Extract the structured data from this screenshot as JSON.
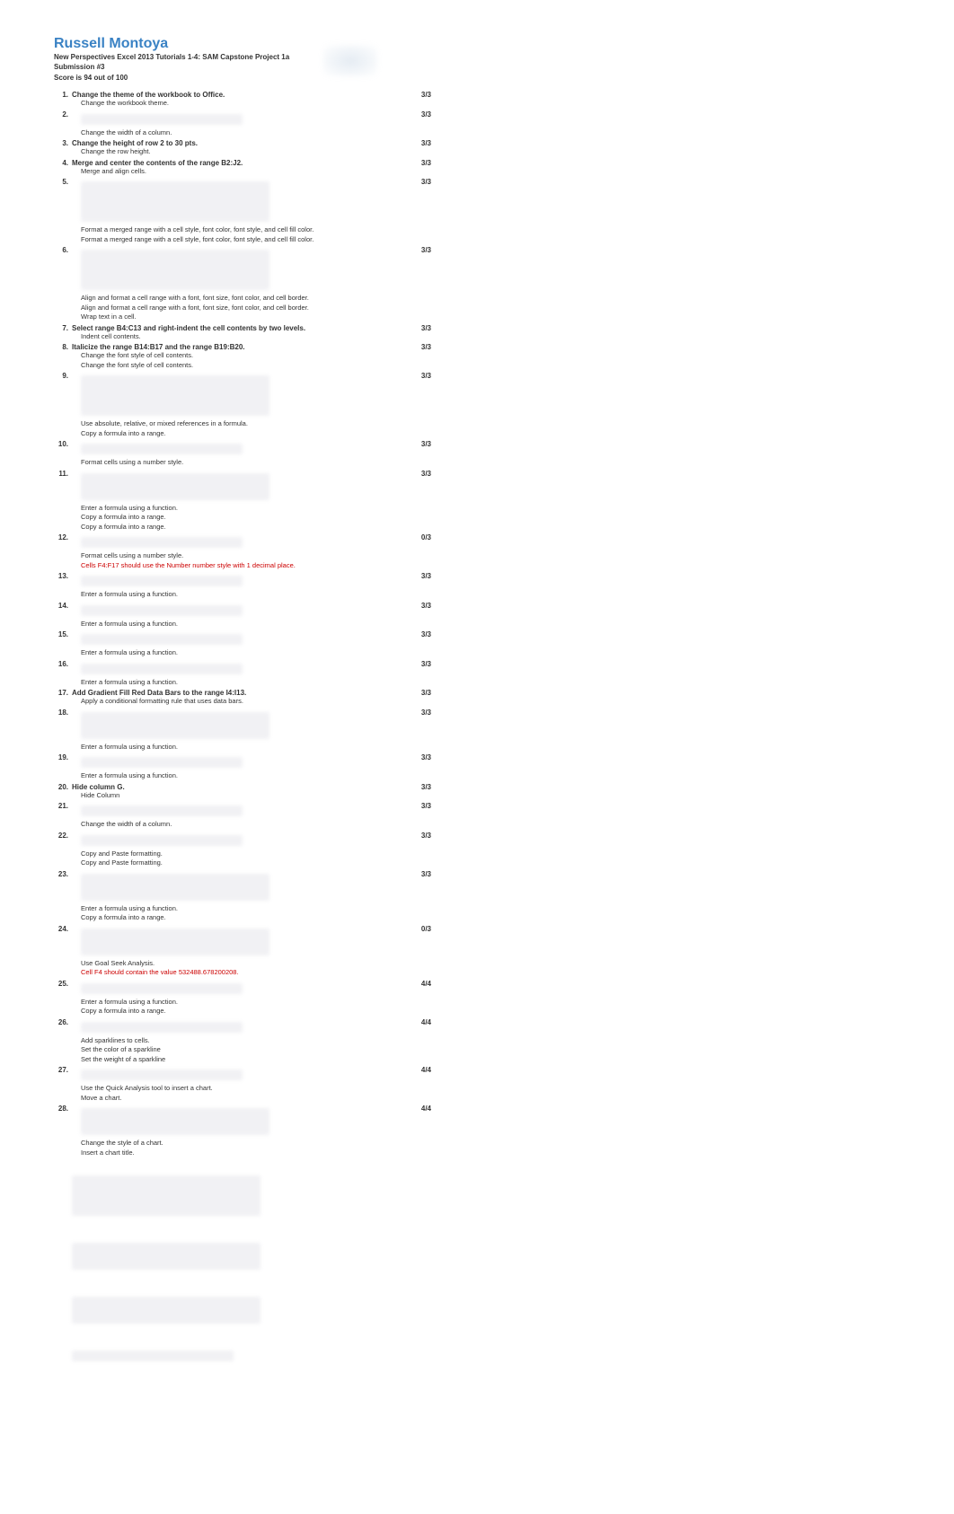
{
  "header": {
    "name": "Russell Montoya",
    "project": "New Perspectives Excel 2013 Tutorials 1-4: SAM Capstone Project 1a",
    "submission": "Submission #3",
    "score": "Score is 94 out of 100"
  },
  "items": [
    {
      "num": "1.",
      "title": "Change the theme of the workbook to Office.",
      "score": "3/3",
      "details": [
        {
          "t": "Change the workbook theme."
        }
      ]
    },
    {
      "num": "2.",
      "title": "",
      "score": "3/3",
      "blur": "sm",
      "details": [
        {
          "t": "Change the width of a column."
        }
      ]
    },
    {
      "num": "3.",
      "title": "Change the height of row 2 to 30 pts.",
      "score": "3/3",
      "details": [
        {
          "t": "Change the row height."
        }
      ]
    },
    {
      "num": "4.",
      "title": "Merge and center the contents of the range B2:J2.",
      "score": "3/3",
      "details": [
        {
          "t": "Merge and align cells."
        }
      ]
    },
    {
      "num": "5.",
      "title": "",
      "score": "3/3",
      "blur": "lg",
      "details": [
        {
          "t": "Format a merged range with a cell style, font color, font style, and cell fill color."
        },
        {
          "t": "Format a merged range with a cell style, font color, font style, and cell fill color."
        }
      ]
    },
    {
      "num": "6.",
      "title": "",
      "score": "3/3",
      "blur": "lg",
      "details": [
        {
          "t": "Align and format a cell range with a font, font size, font color, and cell border."
        },
        {
          "t": "Align and format a cell range with a font, font size, font color, and cell border."
        },
        {
          "t": "Wrap text in a cell."
        }
      ]
    },
    {
      "num": "7.",
      "title": "Select range B4:C13 and right-indent the cell contents by two levels.",
      "score": "3/3",
      "details": [
        {
          "t": "Indent cell contents."
        }
      ]
    },
    {
      "num": "8.",
      "title": "Italicize the range B14:B17 and the range B19:B20.",
      "score": "3/3",
      "details": [
        {
          "t": "Change the font style of cell contents."
        },
        {
          "t": "Change the font style of cell contents."
        }
      ]
    },
    {
      "num": "9.",
      "title": "",
      "score": "3/3",
      "blur": "lg",
      "details": [
        {
          "t": "Use absolute, relative, or mixed references in a formula."
        },
        {
          "t": "Copy a formula into a range."
        }
      ]
    },
    {
      "num": "10.",
      "title": "",
      "score": "3/3",
      "blur": "sm",
      "details": [
        {
          "t": "Format cells using a number style."
        }
      ]
    },
    {
      "num": "11.",
      "title": "",
      "score": "3/3",
      "blur": "md",
      "details": [
        {
          "t": "Enter a formula using a function."
        },
        {
          "t": "Copy a formula into a range."
        },
        {
          "t": "Copy a formula into a range."
        }
      ]
    },
    {
      "num": "12.",
      "title": "",
      "score": "0/3",
      "blur": "sm",
      "details": [
        {
          "t": "Format cells using a number style."
        },
        {
          "t": "Cells F4:F17 should use the Number number style with 1 decimal place.",
          "red": true
        }
      ]
    },
    {
      "num": "13.",
      "title": "",
      "score": "3/3",
      "blur": "sm",
      "details": [
        {
          "t": "Enter a formula using a function."
        }
      ]
    },
    {
      "num": "14.",
      "title": "",
      "score": "3/3",
      "blur": "sm",
      "details": [
        {
          "t": "Enter a formula using a function."
        }
      ]
    },
    {
      "num": "15.",
      "title": "",
      "score": "3/3",
      "blur": "sm",
      "details": [
        {
          "t": "Enter a formula using a function."
        }
      ]
    },
    {
      "num": "16.",
      "title": "",
      "score": "3/3",
      "blur": "sm",
      "details": [
        {
          "t": "Enter a formula using a function."
        }
      ]
    },
    {
      "num": "17.",
      "title": "Add Gradient Fill Red Data Bars to the range I4:I13.",
      "score": "3/3",
      "details": [
        {
          "t": "Apply a conditional formatting rule that uses data bars."
        }
      ]
    },
    {
      "num": "18.",
      "title": "",
      "score": "3/3",
      "blur": "md",
      "details": [
        {
          "t": "Enter a formula using a function."
        }
      ]
    },
    {
      "num": "19.",
      "title": "",
      "score": "3/3",
      "blur": "sm",
      "details": [
        {
          "t": "Enter a formula using a function."
        }
      ]
    },
    {
      "num": "20.",
      "title": "Hide column G.",
      "score": "3/3",
      "details": [
        {
          "t": "Hide Column"
        }
      ]
    },
    {
      "num": "21.",
      "title": "",
      "score": "3/3",
      "blur": "sm",
      "details": [
        {
          "t": "Change the width of a column."
        }
      ]
    },
    {
      "num": "22.",
      "title": "",
      "score": "3/3",
      "blur": "sm",
      "details": [
        {
          "t": "Copy and Paste formatting."
        },
        {
          "t": "Copy and Paste formatting."
        }
      ]
    },
    {
      "num": "23.",
      "title": "",
      "score": "3/3",
      "blur": "md",
      "details": [
        {
          "t": "Enter a formula using a function."
        },
        {
          "t": "Copy a formula into a range."
        }
      ]
    },
    {
      "num": "24.",
      "title": "",
      "score": "0/3",
      "blur": "md",
      "details": [
        {
          "t": "Use Goal Seek Analysis."
        },
        {
          "t": "Cell F4 should contain the value 532488.678200208.",
          "red": true
        }
      ]
    },
    {
      "num": "25.",
      "title": "",
      "score": "4/4",
      "blur": "sm",
      "details": [
        {
          "t": "Enter a formula using a function."
        },
        {
          "t": "Copy a formula into a range."
        }
      ]
    },
    {
      "num": "26.",
      "title": "",
      "score": "4/4",
      "blur": "sm",
      "details": [
        {
          "t": "Add sparklines to cells."
        },
        {
          "t": "Set the color of a sparkline"
        },
        {
          "t": "Set the weight of a sparkline"
        }
      ]
    },
    {
      "num": "27.",
      "title": "",
      "score": "4/4",
      "blur": "sm",
      "details": [
        {
          "t": "Use the Quick Analysis tool to insert a chart."
        },
        {
          "t": "Move a chart."
        }
      ]
    },
    {
      "num": "28.",
      "title": "",
      "score": "4/4",
      "blur": "md",
      "details": [
        {
          "t": "Change the style of a chart."
        },
        {
          "t": "Insert a chart title."
        }
      ]
    }
  ]
}
